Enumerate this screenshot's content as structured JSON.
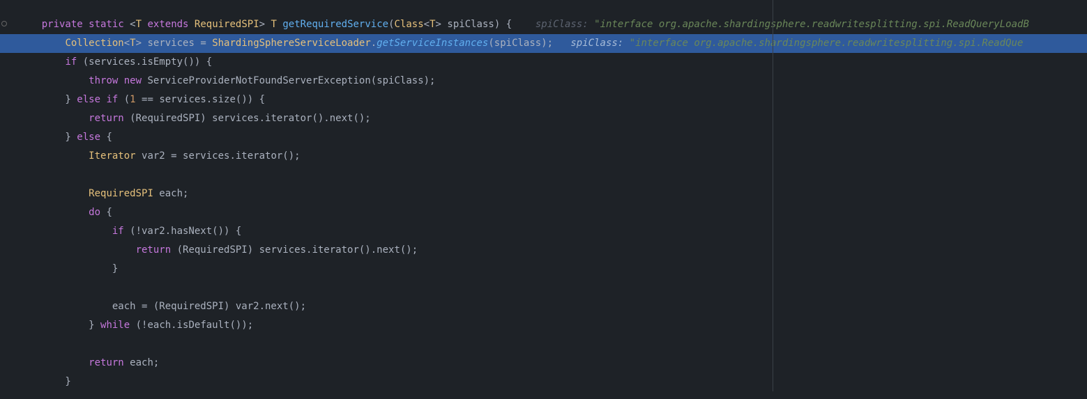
{
  "line1": {
    "i1": "    ",
    "kw1": "private",
    "kw2": "static",
    "op1": " <",
    "type1": "T",
    "kw3": " extends ",
    "type2": "RequiredSPI",
    "op2": "> ",
    "type3": "T",
    "sp": " ",
    "fn": "getRequiredService",
    "op3": "(",
    "type4": "Class",
    "op4": "<",
    "type5": "T",
    "op5": "> ",
    "id1": "spiClass",
    "op6": ") {",
    "hintgap": "    ",
    "hintlabel": "spiClass: ",
    "hintval": "\"interface org.apache.shardingsphere.readwritesplitting.spi.ReadQueryLoadB"
  },
  "line2": {
    "i1": "        ",
    "type1": "Collection",
    "op1": "<",
    "type2": "T",
    "op2": "> ",
    "id1": "services = ",
    "type3": "ShardingSphereServiceLoader",
    "op3": ".",
    "fn": "getServiceInstances",
    "op4": "(spiClass);",
    "hintgap": "   ",
    "hintlabel": "spiClass: ",
    "hintval": "\"interface org.apache.shardingsphere.readwritesplitting.spi.ReadQue"
  },
  "line3": {
    "i1": "        ",
    "kw1": "if",
    "rest": " (services.isEmpty()) {"
  },
  "line4": {
    "i1": "            ",
    "kw1": "throw",
    "kw2": " new ",
    "rest": "ServiceProviderNotFoundServerException(spiClass);"
  },
  "line5": {
    "i1": "        } ",
    "kw1": "else if",
    "op1": " (",
    "num": "1",
    "rest": " == services.size()) {"
  },
  "line6": {
    "i1": "            ",
    "kw1": "return",
    "rest": " (RequiredSPI) services.iterator().next();"
  },
  "line7": {
    "i1": "        } ",
    "kw1": "else",
    "rest": " {"
  },
  "line8": {
    "i1": "            ",
    "type1": "Iterator",
    "rest": " var2 = services.iterator();"
  },
  "line9": {
    "blank": ""
  },
  "line10": {
    "i1": "            ",
    "type1": "RequiredSPI",
    "rest": " each;"
  },
  "line11": {
    "i1": "            ",
    "kw1": "do",
    "rest": " {"
  },
  "line12": {
    "i1": "                ",
    "kw1": "if",
    "rest": " (!var2.hasNext()) {"
  },
  "line13": {
    "i1": "                    ",
    "kw1": "return",
    "rest": " (RequiredSPI) services.iterator().next();"
  },
  "line14": {
    "text": "                }"
  },
  "line15": {
    "blank": ""
  },
  "line16": {
    "text": "                each = (RequiredSPI) var2.next();"
  },
  "line17": {
    "i1": "            } ",
    "kw1": "while",
    "rest": " (!each.isDefault());"
  },
  "line18": {
    "blank": ""
  },
  "line19": {
    "i1": "            ",
    "kw1": "return",
    "rest": " each;"
  },
  "line20": {
    "text": "        }"
  }
}
